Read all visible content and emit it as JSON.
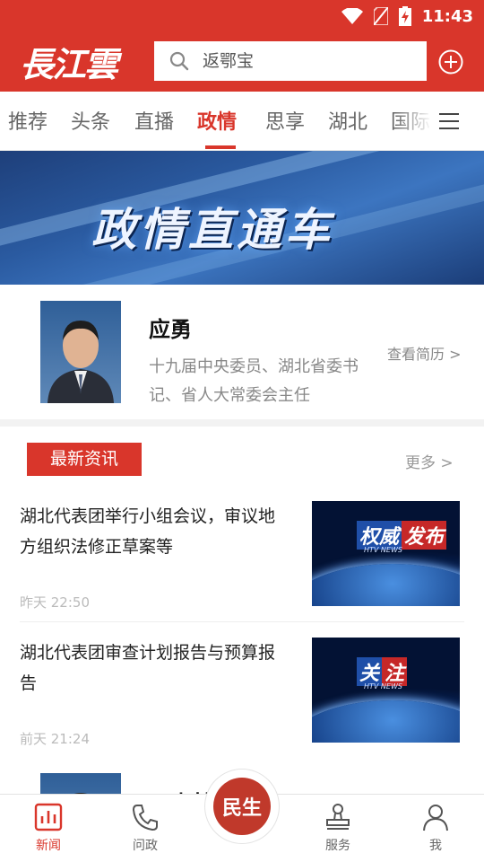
{
  "status_bar": {
    "time": "11:43"
  },
  "header": {
    "logo_text": "長江雲",
    "search_placeholder": "返鄂宝"
  },
  "tabs": [
    {
      "label": "推荐",
      "active": false
    },
    {
      "label": "头条",
      "active": false
    },
    {
      "label": "直播",
      "active": false
    },
    {
      "label": "政情",
      "active": true
    },
    {
      "label": "思享",
      "active": false
    },
    {
      "label": "湖北",
      "active": false
    },
    {
      "label": "国际",
      "active": false
    }
  ],
  "banner": {
    "title": "政情直通车"
  },
  "leader": {
    "name": "应勇",
    "description": "十九届中央委员、湖北省委书记、省人大常委会主任",
    "resume_link": "查看简历 >"
  },
  "news": {
    "section_title": "最新资讯",
    "more_link": "更多 >",
    "articles": [
      {
        "title": "湖北代表团举行小组会议，审议地方组织法修正草案等",
        "time": "昨天 22:50",
        "badge_left": "权威",
        "badge_right": "发布",
        "badge_sub": "HTV NEWS"
      },
      {
        "title": "湖北代表团审查计划报告与预算报告",
        "time": "前天 21:24",
        "badge_left": "关",
        "badge_right": "注",
        "badge_sub": "HTV NEWS"
      }
    ]
  },
  "leader2": {
    "name": "王忠林"
  },
  "bottom_nav": {
    "items": [
      {
        "label": "新闻",
        "active": true
      },
      {
        "label": "问政",
        "active": false
      },
      {
        "label": "服务",
        "active": false
      },
      {
        "label": "我",
        "active": false
      }
    ],
    "center_label": "民生"
  },
  "colors": {
    "brand_red": "#d9362b",
    "banner_blue": "#2a5aa0"
  }
}
